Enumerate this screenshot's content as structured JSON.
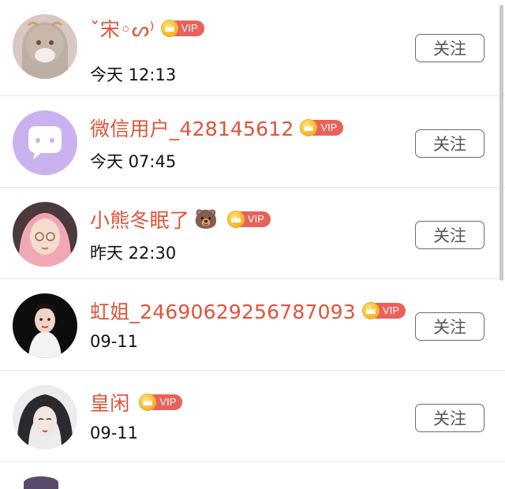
{
  "users": [
    {
      "name": "ˇ宋◦ᔕ⁾",
      "emoji": "",
      "vip": "VIP",
      "time": "今天 12:13",
      "follow": "关注"
    },
    {
      "name": "微信用户_428145612",
      "emoji": "",
      "vip": "VIP",
      "time": "今天 07:45",
      "follow": "关注"
    },
    {
      "name": "小熊冬眠了",
      "emoji": "🐻",
      "vip": "VIP",
      "time": "昨天 22:30",
      "follow": "关注"
    },
    {
      "name": "虹姐_24690629256787093",
      "emoji": "",
      "vip": "VIP",
      "time": "09-11",
      "follow": "关注"
    },
    {
      "name": "皇闲",
      "emoji": "",
      "vip": "VIP",
      "time": "09-11",
      "follow": "关注"
    }
  ],
  "colors": {
    "name": "#e0533a",
    "vip_tag": "#e9615a",
    "crown": "#f3b21f"
  },
  "icons": {
    "vip_badge": "crown-icon",
    "wechat_avatar": "chat-bubble-icon"
  }
}
